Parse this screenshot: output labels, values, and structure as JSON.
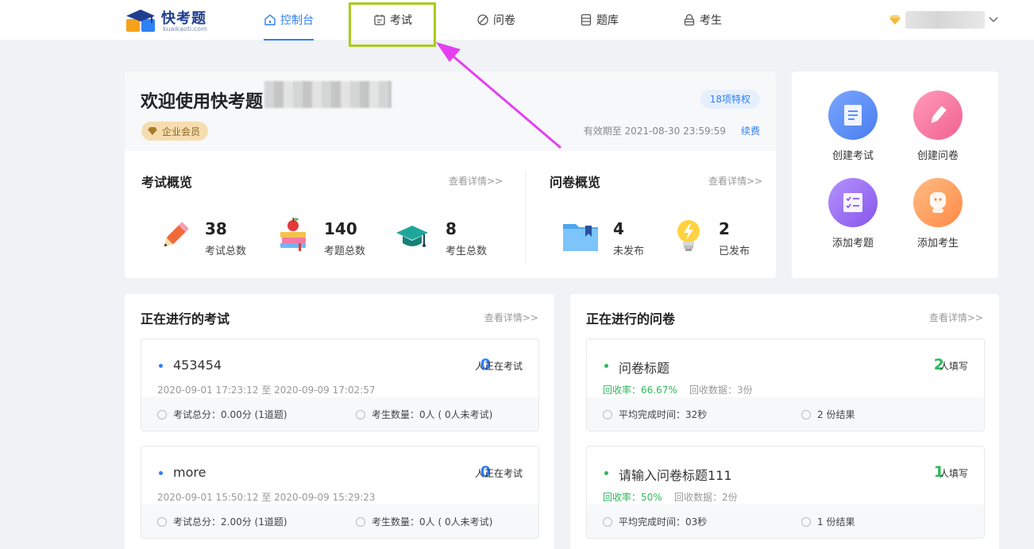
{
  "brand": {
    "name": "快考题",
    "domain": "kuaikaoti.com"
  },
  "nav": [
    {
      "label": "控制台",
      "icon": "home-icon",
      "active": true
    },
    {
      "label": "考试",
      "icon": "calendar-icon",
      "active": false
    },
    {
      "label": "问卷",
      "icon": "leaf-icon",
      "active": false
    },
    {
      "label": "题库",
      "icon": "database-icon",
      "active": false
    },
    {
      "label": "考生",
      "icon": "lock-person-icon",
      "active": false
    }
  ],
  "welcome": {
    "title": "欢迎使用快考题",
    "member_badge": "企业会员",
    "privileges": "18项特权",
    "expire": "有效期至 2021-08-30 23:59:59",
    "renew": "续费"
  },
  "exam_overview": {
    "title": "考试概览",
    "more": "查看详情>>",
    "stats": [
      {
        "value": "38",
        "label": "考试总数",
        "icon": "pencil-icon"
      },
      {
        "value": "140",
        "label": "考题总数",
        "icon": "books-apple-icon"
      },
      {
        "value": "8",
        "label": "考生总数",
        "icon": "graduation-cap-icon"
      }
    ]
  },
  "survey_overview": {
    "title": "问卷概览",
    "more": "查看详情>>",
    "stats": [
      {
        "value": "4",
        "label": "未发布",
        "icon": "folder-icon"
      },
      {
        "value": "2",
        "label": "已发布",
        "icon": "lightbulb-icon"
      }
    ]
  },
  "quick_actions": [
    {
      "label": "创建考试",
      "icon": "document-icon",
      "color": "#5b8ff9"
    },
    {
      "label": "创建问卷",
      "icon": "pen-icon",
      "color": "#f7729a"
    },
    {
      "label": "添加考题",
      "icon": "checklist-icon",
      "color": "#9a6cf0"
    },
    {
      "label": "添加考生",
      "icon": "person-icon",
      "color": "#ff9a5c"
    }
  ],
  "ongoing_exams": {
    "title": "正在进行的考试",
    "more": "查看详情>>",
    "items": [
      {
        "title": "453454",
        "count": "0",
        "count_label": "人正在考试",
        "time": "2020-09-01 17:23:12 至 2020-09-09 17:02:57",
        "score": "考试总分：0.00分 (1道题)",
        "takers": "考生数量：0人 ( 0人未考试)"
      },
      {
        "title": "more",
        "count": "0",
        "count_label": "人正在考试",
        "time": "2020-09-01 15:50:12 至 2020-09-09 15:29:23",
        "score": "考试总分：2.00分 (1道题)",
        "takers": "考生数量：0人 ( 0人未考试)"
      }
    ]
  },
  "ongoing_surveys": {
    "title": "正在进行的问卷",
    "more": "查看详情>>",
    "items": [
      {
        "title": "问卷标题",
        "count": "2",
        "count_label": "人填写",
        "rate": "回收率：66.67%",
        "collected": "回收数据：3份",
        "avg_time": "平均完成时间：32秒",
        "results": "2 份结果"
      },
      {
        "title": "请输入问卷标题111",
        "count": "1",
        "count_label": "人填写",
        "rate": "回收率：50%",
        "collected": "回收数据：2份",
        "avg_time": "平均完成时间：03秒",
        "results": "1 份结果"
      }
    ]
  },
  "colors": {
    "primary": "#2f7ff5",
    "green": "#2fb85b",
    "highlight": "#a9cc1a",
    "arrow": "#e43ff0"
  }
}
